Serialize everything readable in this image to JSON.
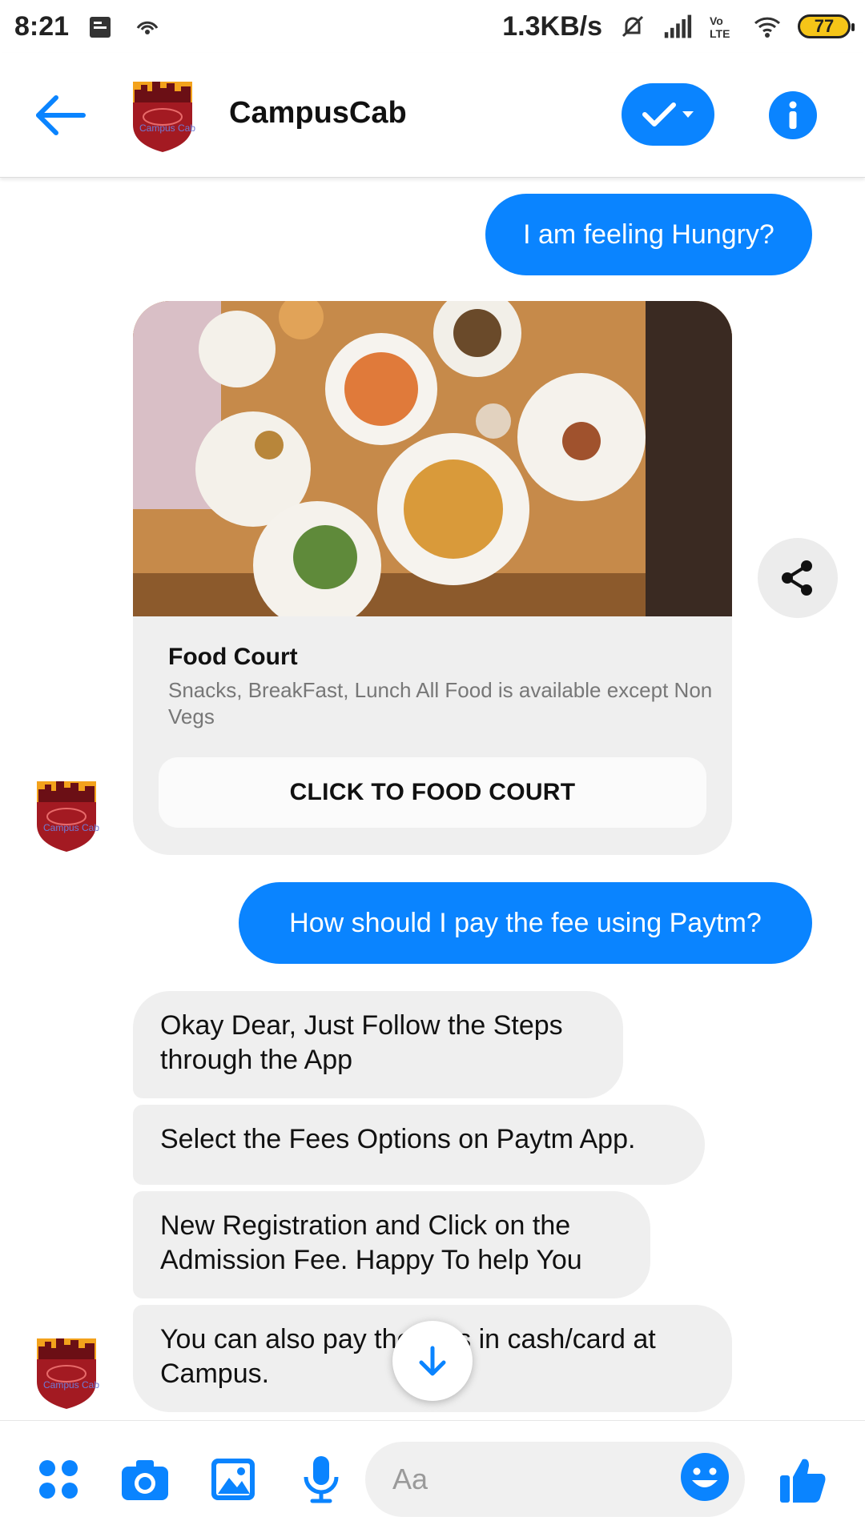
{
  "status_bar": {
    "time": "8:21",
    "network_speed": "1.3KB/s",
    "battery_level": "77",
    "icons": [
      "notification-icon",
      "hotspot-icon",
      "mute-icon",
      "signal-icon",
      "volte-icon",
      "wifi-icon",
      "battery-icon"
    ]
  },
  "header": {
    "title": "CampusCab",
    "avatar_text": "Campus Cab",
    "colors": {
      "accent": "#0a84ff"
    }
  },
  "messages": {
    "outgoing_1": "I am feeling Hungry?",
    "card": {
      "title": "Food Court",
      "subtitle": "Snacks, BreakFast, Lunch All Food is available except Non Vegs",
      "button_label": "CLICK TO FOOD COURT"
    },
    "outgoing_2": "How should I pay the fee using Paytm?",
    "incoming": [
      "Okay Dear, Just Follow the Steps through the App",
      "Select the Fees Options on Paytm App.",
      "New Registration and Click on the Admission Fee. Happy To help You",
      "You can also pay the fees in cash/card at Campus."
    ]
  },
  "composer": {
    "placeholder": "Aa",
    "icons": [
      "apps-icon",
      "camera-icon",
      "gallery-icon",
      "microphone-icon",
      "emoji-icon",
      "thumbs-up-icon"
    ]
  }
}
